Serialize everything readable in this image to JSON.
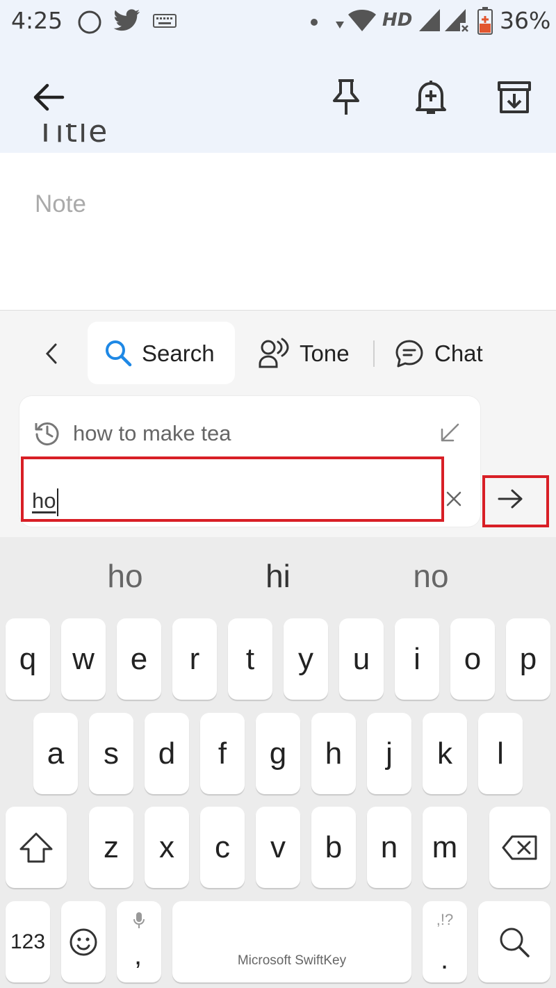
{
  "status_bar": {
    "time": "4:25",
    "network_label": "HD",
    "battery": "36%",
    "icons": [
      "circle-icon",
      "twitter-icon",
      "keyboard-icon",
      "dot-icon",
      "data-arrows-icon",
      "wifi-icon",
      "signal-icon",
      "signal-noservice-icon",
      "battery-charging-icon"
    ]
  },
  "header": {
    "icons": [
      "back-arrow-icon",
      "pin-icon",
      "reminder-bell-icon",
      "archive-icon"
    ]
  },
  "note": {
    "title_peek": "Title",
    "placeholder": "Note"
  },
  "toolbar": {
    "tabs": [
      {
        "label": "Search",
        "icon": "search-icon",
        "selected": true
      },
      {
        "label": "Tone",
        "icon": "tone-icon",
        "selected": false
      },
      {
        "label": "Chat",
        "icon": "chat-icon",
        "selected": false
      }
    ]
  },
  "search": {
    "history_item": "how to make tea",
    "input_value": "ho",
    "highlight_color": "#d81f26"
  },
  "keyboard": {
    "suggestions": [
      "ho",
      "hi",
      "no"
    ],
    "row1": [
      "q",
      "w",
      "e",
      "r",
      "t",
      "y",
      "u",
      "i",
      "o",
      "p"
    ],
    "row2": [
      "a",
      "s",
      "d",
      "f",
      "g",
      "h",
      "j",
      "k",
      "l"
    ],
    "row3": [
      "z",
      "x",
      "c",
      "v",
      "b",
      "n",
      "m"
    ],
    "numbers_key": "123",
    "comma_key": ",",
    "period_key": ".",
    "punct_hint": ",!?",
    "space_label": "Microsoft SwiftKey"
  }
}
